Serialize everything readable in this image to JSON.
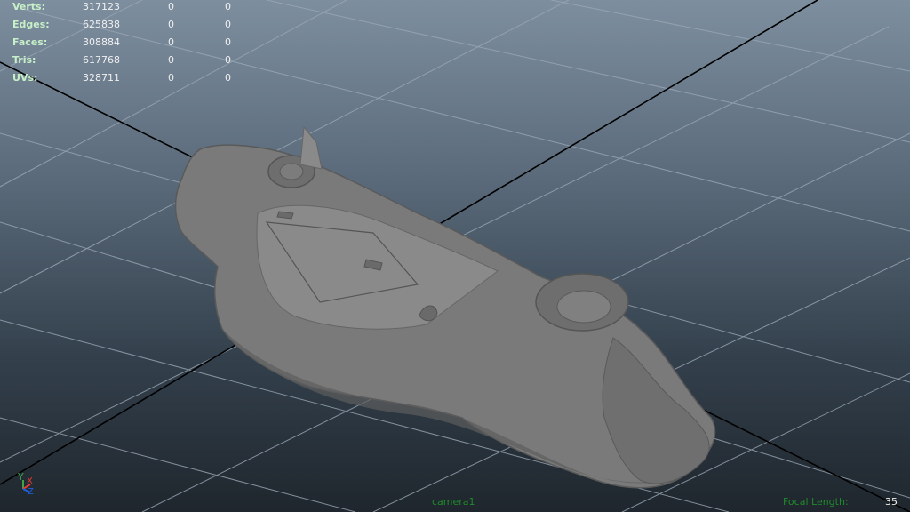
{
  "stats": [
    {
      "label": "Verts:",
      "values": [
        "317123",
        "0",
        "0"
      ]
    },
    {
      "label": "Edges:",
      "values": [
        "625838",
        "0",
        "0"
      ]
    },
    {
      "label": "Faces:",
      "values": [
        "308884",
        "0",
        "0"
      ]
    },
    {
      "label": "Tris:",
      "values": [
        "617768",
        "0",
        "0"
      ]
    },
    {
      "label": "UVs:",
      "values": [
        "328711",
        "0",
        "0"
      ]
    }
  ],
  "camera_name": "camera1",
  "focal_length_label": "Focal Length:",
  "focal_length_value": "35",
  "axis_labels": {
    "x": "X",
    "y": "Y",
    "z": "Z"
  },
  "colors": {
    "grid": "#9aa8b5",
    "axis_line": "#000000",
    "model": "#7a7a7a",
    "hud_label": "#c8f0c8",
    "camera_label": "#1f8a2a",
    "axis_x": "#e53935",
    "axis_y": "#43a047",
    "axis_z": "#1e5fe0"
  }
}
